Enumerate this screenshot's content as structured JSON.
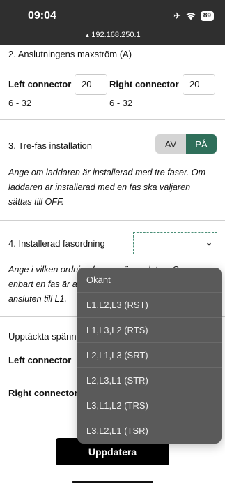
{
  "status_bar": {
    "time": "09:04",
    "battery": "89",
    "url": "192.168.250.1"
  },
  "max_current": {
    "title": "2. Anslutningens maxström (A)",
    "left_label": "Left connector",
    "left_value": "20",
    "left_range": "6 - 32",
    "right_label": "Right connector",
    "right_value": "20",
    "right_range": "6 - 32"
  },
  "three_phase": {
    "title": "3. Tre-fas installation",
    "off_label": "AV",
    "on_label": "PÅ",
    "selected": "PÅ",
    "description_lines": [
      "Ange om laddaren är installerad med tre faser. Om",
      "laddaren är installerad med en fas ska väljaren",
      "sättas till OFF."
    ]
  },
  "phase_order": {
    "title": "4. Installerad fasordning",
    "selected_value": "",
    "description_lines": [
      "Ange i vilken ordning faserna är anslutna. Om",
      "enbart en fas är ansluten, ange den fas som är",
      "ansluten till L1."
    ],
    "options": [
      "Okänt",
      "L1,L2,L3 (RST)",
      "L1,L3,L2 (RTS)",
      "L2,L1,L3 (SRT)",
      "L2,L3,L1 (STR)",
      "L3,L1,L2 (TRS)",
      "L3,L2,L1 (TSR)"
    ]
  },
  "detected": {
    "title": "Upptäckta spänningar",
    "left_label": "Left connector",
    "right_label": "Right connector"
  },
  "update_button": "Uppdatera",
  "colors": {
    "accent": "#2f6f5a",
    "dropdown_bg": "#5a5a5a",
    "statusbar_bg": "#2f2f2f"
  }
}
